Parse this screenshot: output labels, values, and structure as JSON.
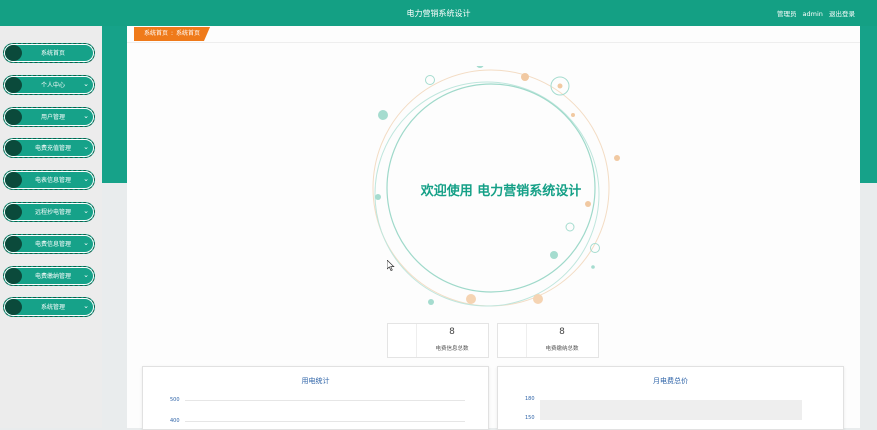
{
  "app": {
    "title": "电力营销系统设计"
  },
  "header": {
    "user_role": "管理员",
    "username": "admin",
    "logout": "退出登录"
  },
  "sidebar": {
    "items": [
      {
        "label": "系统首页",
        "has_submenu": false
      },
      {
        "label": "个人中心",
        "has_submenu": true
      },
      {
        "label": "用户管理",
        "has_submenu": true
      },
      {
        "label": "电费充值管理",
        "has_submenu": true
      },
      {
        "label": "电表信息管理",
        "has_submenu": true
      },
      {
        "label": "远程抄电管理",
        "has_submenu": true
      },
      {
        "label": "电费信息管理",
        "has_submenu": true
      },
      {
        "label": "电费缴纳管理",
        "has_submenu": true
      },
      {
        "label": "系统管理",
        "has_submenu": true
      }
    ]
  },
  "breadcrumb": {
    "root": "系统首页",
    "separator": ":",
    "current": "系统首页"
  },
  "welcome": {
    "text": "欢迎使用 电力营销系统设计"
  },
  "stats": [
    {
      "value": "8",
      "label": "电费信息总数"
    },
    {
      "value": "8",
      "label": "电费缴纳总数"
    }
  ],
  "charts": [
    {
      "title": "用电统计",
      "ticks": [
        "500",
        "400"
      ]
    },
    {
      "title": "月电费总价",
      "ticks": [
        "180",
        "150"
      ]
    }
  ],
  "colors": {
    "primary": "#16a289",
    "accent": "#ef7a1a",
    "chart_text": "#2f64a8"
  },
  "icons": {
    "submenu": "chevron-down-icon",
    "nav": "circle-icon",
    "cursor": "cursor-arrow-icon"
  }
}
